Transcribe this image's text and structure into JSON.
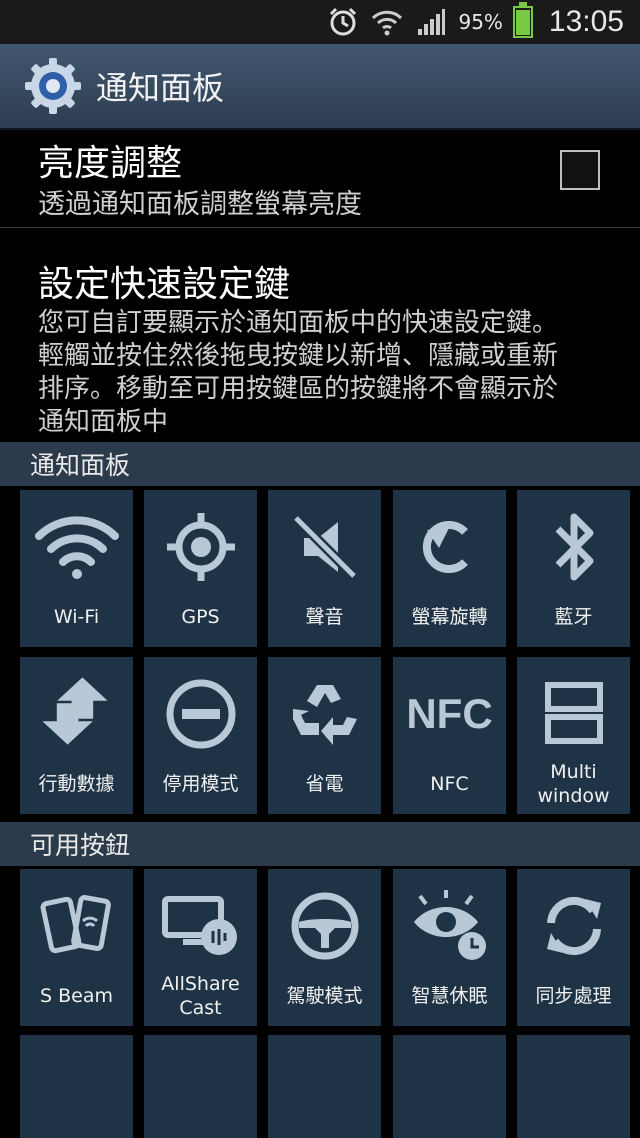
{
  "statusbar": {
    "battery_percent": "95%",
    "time": "13:05",
    "battery_level": 0.95,
    "icons": [
      "alarm-icon",
      "wifi-icon",
      "signal-icon",
      "battery-icon"
    ]
  },
  "actionbar": {
    "title": "通知面板",
    "icon": "settings-gear-icon"
  },
  "brightness": {
    "title": "亮度調整",
    "subtitle": "透過通知面板調整螢幕亮度",
    "checked": false
  },
  "quick_settings": {
    "title": "設定快速設定鍵",
    "description": "您可自訂要顯示於通知面板中的快速設定鍵。輕觸並按住然後拖曳按鍵以新增、隱藏或重新排序。移動至可用按鍵區的按鍵將不會顯示於通知面板中"
  },
  "section_panel": {
    "label": "通知面板"
  },
  "section_available": {
    "label": "可用按鈕"
  },
  "panel_tiles": [
    {
      "label": "Wi-Fi",
      "icon": "wifi-icon"
    },
    {
      "label": "GPS",
      "icon": "gps-icon"
    },
    {
      "label": "聲音",
      "icon": "sound-mute-icon"
    },
    {
      "label": "螢幕旋轉",
      "icon": "rotate-icon"
    },
    {
      "label": "藍牙",
      "icon": "bluetooth-icon"
    },
    {
      "label": "行動數據",
      "icon": "mobile-data-icon"
    },
    {
      "label": "停用模式",
      "icon": "blocking-mode-icon"
    },
    {
      "label": "省電",
      "icon": "power-saving-icon"
    },
    {
      "label": "NFC",
      "icon": "nfc-icon",
      "icon_text": "NFC"
    },
    {
      "label": "Multi window",
      "icon": "multi-window-icon"
    }
  ],
  "available_tiles": [
    {
      "label": "S Beam",
      "icon": "s-beam-icon"
    },
    {
      "label": "AllShare Cast",
      "icon": "allshare-cast-icon"
    },
    {
      "label": "駕駛模式",
      "icon": "driving-mode-icon"
    },
    {
      "label": "智慧休眠",
      "icon": "smart-stay-icon"
    },
    {
      "label": "同步處理",
      "icon": "sync-icon"
    }
  ],
  "colors": {
    "accent": "#1e3345",
    "header": "#2c3b4b",
    "battery": "#7ac943",
    "actionbar": "#41576f"
  }
}
